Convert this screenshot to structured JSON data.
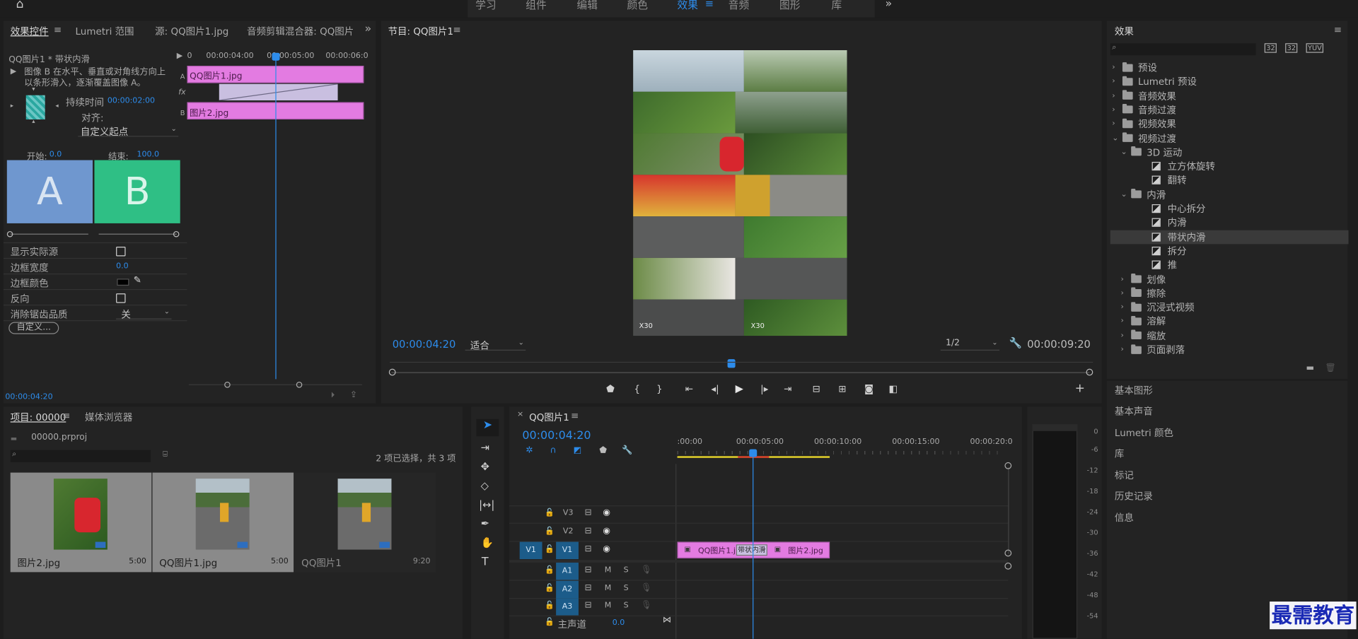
{
  "menu": {
    "items": [
      "学习",
      "组件",
      "编辑",
      "颜色",
      "效果",
      "音频",
      "图形",
      "库"
    ],
    "active_index": 4
  },
  "effect_controls": {
    "tabs": [
      "效果控件",
      "Lumetri 范围",
      "源: QQ图片1.jpg",
      "音频剪辑混合器: QQ图片"
    ],
    "clip_label": "QQ图片1 * 带状内滑",
    "ruler": [
      "0",
      "00:00:04:00",
      "00:00:05:00",
      "00:00:06:0"
    ],
    "description": "图像 B 在水平、垂直或对角线方向上以条形滑入，逐渐覆盖图像 A。",
    "duration_label": "持续时间",
    "duration": "00:00:02:00",
    "align_label": "对齐:",
    "align_value": "自定义起点",
    "clip_a": "QQ图片1.jpg",
    "clip_b": "图片2.jpg",
    "track_a": "A",
    "track_b": "B",
    "fx_icon": "fx",
    "start_label": "开始:",
    "start_value": "0.0",
    "end_label": "结束:",
    "end_value": "100.0",
    "thumb_a": "A",
    "thumb_b": "B",
    "props": [
      {
        "label": "显示实际源"
      },
      {
        "label": "边框宽度",
        "value": "0.0"
      },
      {
        "label": "边框颜色"
      },
      {
        "label": "反向"
      },
      {
        "label": "消除锯齿品质",
        "value": "关"
      }
    ],
    "custom_button": "自定义...",
    "timecode": "00:00:04:20"
  },
  "program": {
    "title": "节目: QQ图片1",
    "timecode": "00:00:04:20",
    "fit": "适合",
    "resolution": "1/2",
    "duration": "00:00:09:20",
    "watermark1": "X30",
    "watermark2": "X30"
  },
  "effects": {
    "title": "效果",
    "search_placeholder": "",
    "icons": [
      "32",
      "32",
      "YUV"
    ],
    "tree": [
      {
        "label": "预设",
        "level": 0,
        "type": "folder",
        "expanded": false
      },
      {
        "label": "Lumetri 预设",
        "level": 0,
        "type": "folder",
        "expanded": false
      },
      {
        "label": "音频效果",
        "level": 0,
        "type": "folder",
        "expanded": false
      },
      {
        "label": "音频过渡",
        "level": 0,
        "type": "folder",
        "expanded": false
      },
      {
        "label": "视频效果",
        "level": 0,
        "type": "folder",
        "expanded": false
      },
      {
        "label": "视频过渡",
        "level": 0,
        "type": "folder",
        "expanded": true
      },
      {
        "label": "3D 运动",
        "level": 1,
        "type": "folder",
        "expanded": true
      },
      {
        "label": "立方体旋转",
        "level": 2,
        "type": "fx"
      },
      {
        "label": "翻转",
        "level": 2,
        "type": "fx"
      },
      {
        "label": "内滑",
        "level": 1,
        "type": "folder",
        "expanded": true
      },
      {
        "label": "中心拆分",
        "level": 2,
        "type": "fx"
      },
      {
        "label": "内滑",
        "level": 2,
        "type": "fx"
      },
      {
        "label": "带状内滑",
        "level": 2,
        "type": "fx",
        "selected": true
      },
      {
        "label": "拆分",
        "level": 2,
        "type": "fx"
      },
      {
        "label": "推",
        "level": 2,
        "type": "fx"
      },
      {
        "label": "划像",
        "level": 1,
        "type": "folder",
        "expanded": false
      },
      {
        "label": "擦除",
        "level": 1,
        "type": "folder",
        "expanded": false
      },
      {
        "label": "沉浸式视频",
        "level": 1,
        "type": "folder",
        "expanded": false
      },
      {
        "label": "溶解",
        "level": 1,
        "type": "folder",
        "expanded": false
      },
      {
        "label": "缩放",
        "level": 1,
        "type": "folder",
        "expanded": false
      },
      {
        "label": "页面剥落",
        "level": 1,
        "type": "folder",
        "expanded": false
      }
    ],
    "sections": [
      "基本图形",
      "基本声音",
      "Lumetri 颜色",
      "库",
      "标记",
      "历史记录",
      "信息"
    ]
  },
  "project": {
    "tabs": [
      "项目: 00000",
      "媒体浏览器"
    ],
    "file": "00000.prproj",
    "selection_info": "2 项已选择，共 3 项",
    "items": [
      {
        "name": "图片2.jpg",
        "duration": "5:00"
      },
      {
        "name": "QQ图片1.jpg",
        "duration": "5:00"
      },
      {
        "name": "QQ图片1",
        "duration": "9:20"
      }
    ]
  },
  "timeline": {
    "title": "QQ图片1",
    "timecode": "00:00:04:20",
    "ruler": [
      ":00:00",
      "00:00:05:00",
      "00:00:10:00",
      "00:00:15:00",
      "00:00:20:0"
    ],
    "video_tracks": [
      "V3",
      "V2",
      "V1"
    ],
    "audio_tracks": [
      "A1",
      "A2",
      "A3"
    ],
    "source_patch": "V1",
    "mute": "M",
    "solo": "S",
    "master_label": "主声道",
    "master_value": "0.0",
    "clip1": "QQ图片1.jp",
    "clip2": "图片2.jpg",
    "transition": "带状内滑"
  },
  "meter": {
    "labels": [
      "0",
      "-6",
      "-12",
      "-18",
      "-24",
      "-30",
      "-36",
      "-42",
      "-48",
      "-54"
    ]
  },
  "watermark": "最需教育",
  "colors": {
    "accent": "#2d8ceb",
    "clip": "#e37be1",
    "thumb_a": "#6f97cf",
    "thumb_b": "#2fbf85",
    "selected": "#3a3a3a",
    "track_on": "#1c5c8a"
  }
}
